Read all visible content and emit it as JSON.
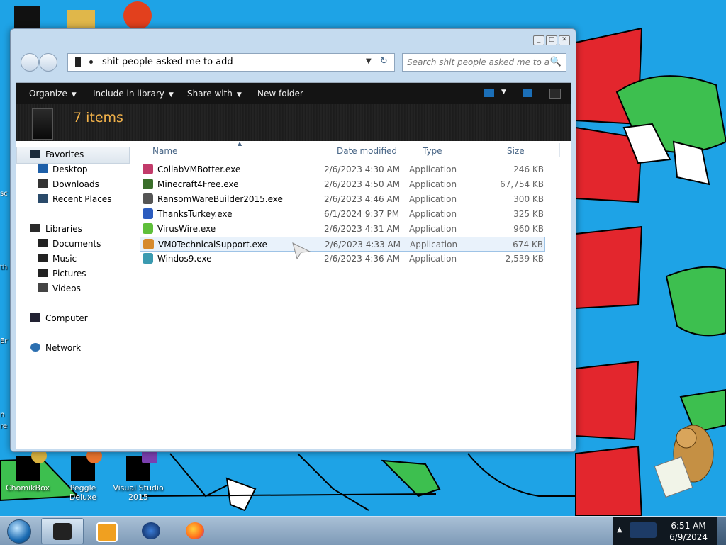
{
  "desktop": {
    "icons": [
      {
        "label": "ChomikBox"
      },
      {
        "label": "Peggle Deluxe"
      },
      {
        "label": "Visual Studio 2015"
      }
    ],
    "edge_text": [
      "sc",
      "th",
      "Er",
      "n",
      "re"
    ]
  },
  "window": {
    "caption_buttons": [
      "_",
      "□",
      "✕"
    ],
    "address": {
      "path": "shit people asked me to add",
      "dropdown_glyph": "▼",
      "refresh_glyph": "↻"
    },
    "search": {
      "placeholder": "Search shit people asked me to add",
      "icon": "search-icon"
    },
    "toolbar": {
      "organize": "Organize",
      "include_in_library": "Include in library",
      "share_with": "Share with",
      "new_folder": "New folder"
    },
    "header": {
      "count": "7 items"
    },
    "nav": {
      "favorites": "Favorites",
      "desktop": "Desktop",
      "downloads": "Downloads",
      "recent_places": "Recent Places",
      "libraries": "Libraries",
      "documents": "Documents",
      "music": "Music",
      "pictures": "Pictures",
      "videos": "Videos",
      "computer": "Computer",
      "network": "Network"
    },
    "columns": {
      "name": "Name",
      "date_modified": "Date modified",
      "type": "Type",
      "size": "Size"
    },
    "files": [
      {
        "name": "CollabVMBotter.exe",
        "date": "2/6/2023 4:30 AM",
        "type": "Application",
        "size": "246 KB",
        "color": "#c23b6a"
      },
      {
        "name": "Minecraft4Free.exe",
        "date": "2/6/2023 4:50 AM",
        "type": "Application",
        "size": "67,754 KB",
        "color": "#3a6e2a"
      },
      {
        "name": "RansomWareBuilder2015.exe",
        "date": "2/6/2023 4:46 AM",
        "type": "Application",
        "size": "300 KB",
        "color": "#555555"
      },
      {
        "name": "ThanksTurkey.exe",
        "date": "6/1/2024 9:37 PM",
        "type": "Application",
        "size": "325 KB",
        "color": "#2c5cbf"
      },
      {
        "name": "VirusWire.exe",
        "date": "2/6/2023 4:31 AM",
        "type": "Application",
        "size": "960 KB",
        "color": "#5fbf3a"
      },
      {
        "name": "VM0TechnicalSupport.exe",
        "date": "2/6/2023 4:33 AM",
        "type": "Application",
        "size": "674 KB",
        "color": "#d68a2c"
      },
      {
        "name": "Windos9.exe",
        "date": "2/6/2023 4:36 AM",
        "type": "Application",
        "size": "2,539 KB",
        "color": "#3a9ab0"
      }
    ]
  },
  "taskbar": {
    "clock_time": "6:51 AM",
    "clock_date": "6/9/2024",
    "tray_up": "▲"
  }
}
